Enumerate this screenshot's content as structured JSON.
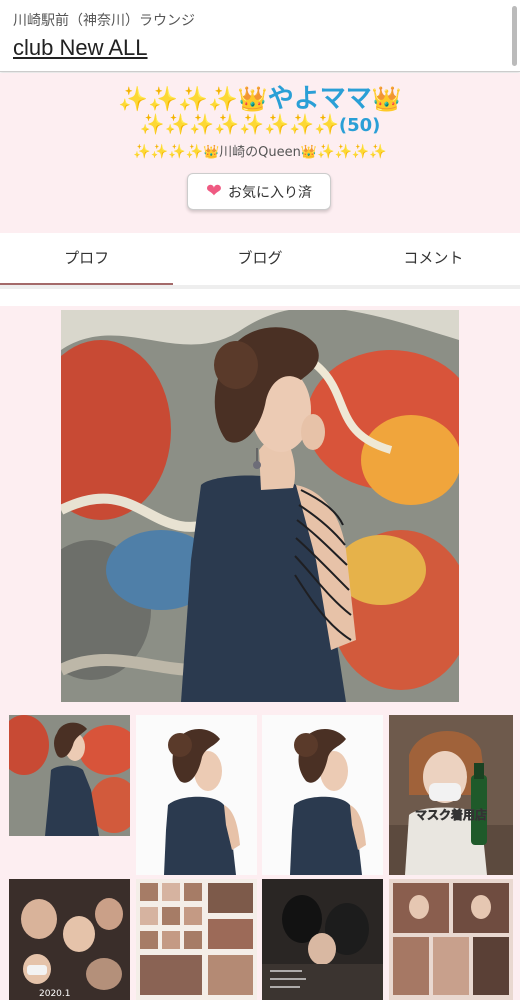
{
  "header": {
    "area": "川崎駅前（神奈川）ラウンジ",
    "shop_name": "club New ALL"
  },
  "profile": {
    "sparkle": "✨",
    "crown": "👑",
    "cast_name": "やよママ",
    "age": "(50)",
    "catchphrase": "川崎のQueen",
    "favorite_label": "お気に入り済",
    "heart_icon": "heart-icon"
  },
  "tabs": [
    {
      "label": "プロフ",
      "active": true
    },
    {
      "label": "ブログ",
      "active": false
    },
    {
      "label": "コメント",
      "active": false
    }
  ],
  "thumbs": {
    "mask_label": "マスク着用店",
    "date_label": "2020.1"
  },
  "colors": {
    "accent": "#a46a6a",
    "name_blue": "#2a9fd6",
    "band_pink": "#fdeef1",
    "heart_pink": "#ef5a82"
  }
}
